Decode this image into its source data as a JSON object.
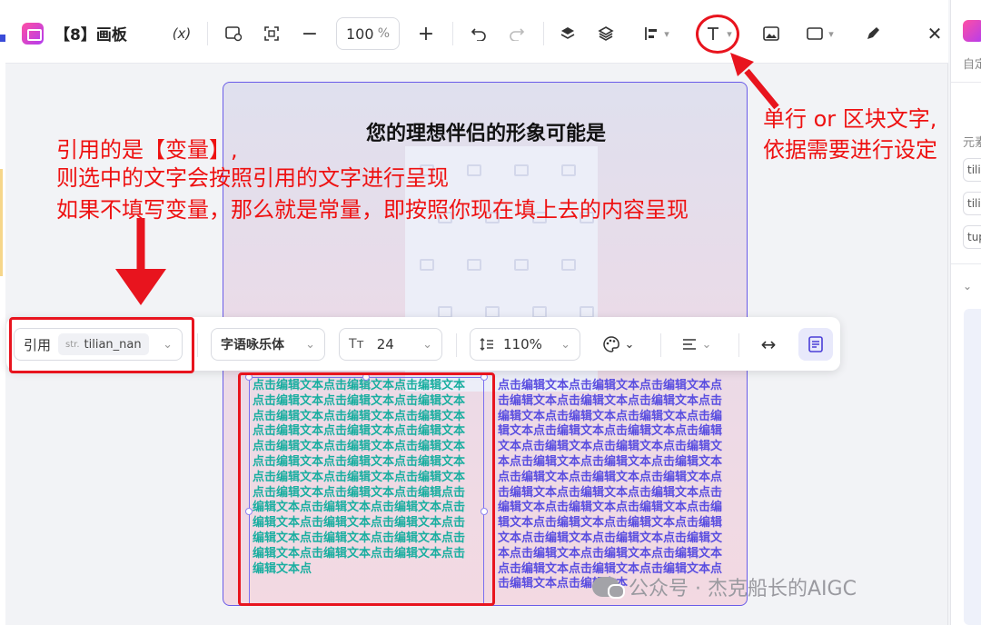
{
  "window": {
    "title": "【8】画板",
    "variable_btn": "(x)",
    "zoom_value": "100",
    "zoom_unit": "%"
  },
  "right_panel": {
    "label_top": "自定",
    "label_elem": "元素",
    "fields": [
      "tili",
      "tili",
      "tup"
    ]
  },
  "artboard": {
    "title": "您的理想伴侣的形象可能是",
    "text_col1": "点击编辑文本点击编辑文本点击编辑文本点击编辑文本点击编辑文本点击编辑文本点击编辑文本点击编辑文本点击编辑文本点击编辑文本点击编辑文本点击编辑文本点击编辑文本点击编辑文本点击编辑文本点击编辑文本点击编辑文本点击编辑文本点击编辑文本点击编辑文本点击编辑文本点击编辑文本点击编辑文本点击编辑点击编辑文本点击编辑文本点击编辑文本点击编辑文本点击编辑文本点击编辑文本点击编辑文本点击编辑文本点击编辑文本点击编辑文本点击编辑文本点击编辑文本点击编辑文本点",
    "text_col2": "点击编辑文本点击编辑文本点击编辑文本点击编辑文本点击编辑文本点击编辑文本点击编辑文本点击编辑文本点击编辑文本点击编辑文本点击编辑文本点击编辑文本点击编辑文本点击编辑文本点击编辑文本点击编辑文本点击编辑文本点击编辑文本点击编辑文本点击编辑文本点击编辑文本点击编辑文本点击编辑文本点击编辑文本点击编辑文本点击编辑文本点击编辑文本点击编辑文本点击编辑文本点击编辑文本点击编辑文本点击编辑文本点击编辑文本点击编辑文本点击编辑文本点击编辑文本点击编辑文本点击编辑文本点击编辑文本点击编辑文本点击编辑文本点击编辑文本点击编辑文本"
  },
  "text_toolbar": {
    "reference_label": "引用",
    "variable_prefix": "str.",
    "variable_name": "tilian_nan",
    "font_family": "字语咏乐体",
    "font_size": "24",
    "line_height": "110%"
  },
  "annotations": {
    "left_lines": [
      "引用的是【变量】,",
      "则选中的文字会按照引用的文字进行呈现",
      "如果不填写变量，那么就是常量，即按照你现在填上去的内容呈现"
    ],
    "right_lines": [
      "单行 or 区块文字,",
      "依据需要进行设定"
    ]
  },
  "watermark": "公众号 · 杰克船长的AIGC",
  "colors": {
    "accent": "#5b4fe0",
    "annotation_red": "#e8141e",
    "text_teal": "#1aaea0",
    "text_purple": "#5a4ee0"
  }
}
